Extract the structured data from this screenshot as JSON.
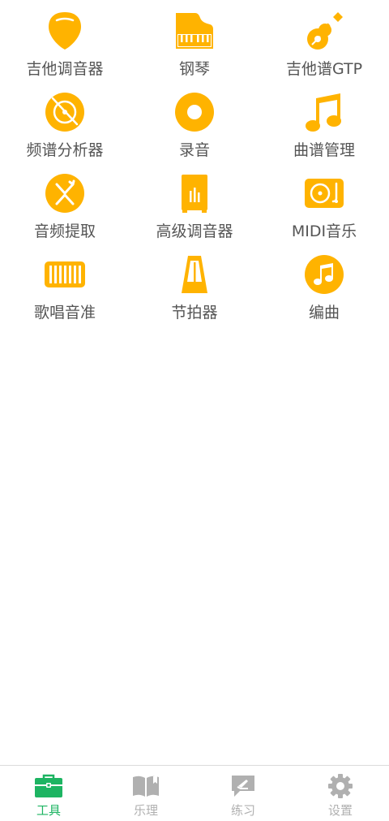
{
  "colors": {
    "accent_tool": "#FFB300",
    "tab_active": "#1DB462",
    "tab_inactive": "#B0B0B0",
    "label_text": "#555555"
  },
  "tools": [
    {
      "label": "吉他调音器",
      "icon": "guitar-pick-icon"
    },
    {
      "label": "钢琴",
      "icon": "piano-icon"
    },
    {
      "label": "吉他谱GTP",
      "icon": "guitar-icon"
    },
    {
      "label": "频谱分析器",
      "icon": "disc-analyzer-icon"
    },
    {
      "label": "录音",
      "icon": "record-icon"
    },
    {
      "label": "曲谱管理",
      "icon": "music-note-double-icon"
    },
    {
      "label": "音频提取",
      "icon": "audio-extract-icon"
    },
    {
      "label": "高级调音器",
      "icon": "advanced-tuner-icon"
    },
    {
      "label": "MIDI音乐",
      "icon": "turntable-icon"
    },
    {
      "label": "歌唱音准",
      "icon": "keyboard-icon"
    },
    {
      "label": "节拍器",
      "icon": "metronome-icon"
    },
    {
      "label": "编曲",
      "icon": "music-note-circle-icon"
    }
  ],
  "tabbar": {
    "active_index": 0,
    "tabs": [
      {
        "label": "工具",
        "icon": "toolbox-icon"
      },
      {
        "label": "乐理",
        "icon": "book-icon"
      },
      {
        "label": "练习",
        "icon": "practice-chat-icon"
      },
      {
        "label": "设置",
        "icon": "gear-icon"
      }
    ]
  }
}
